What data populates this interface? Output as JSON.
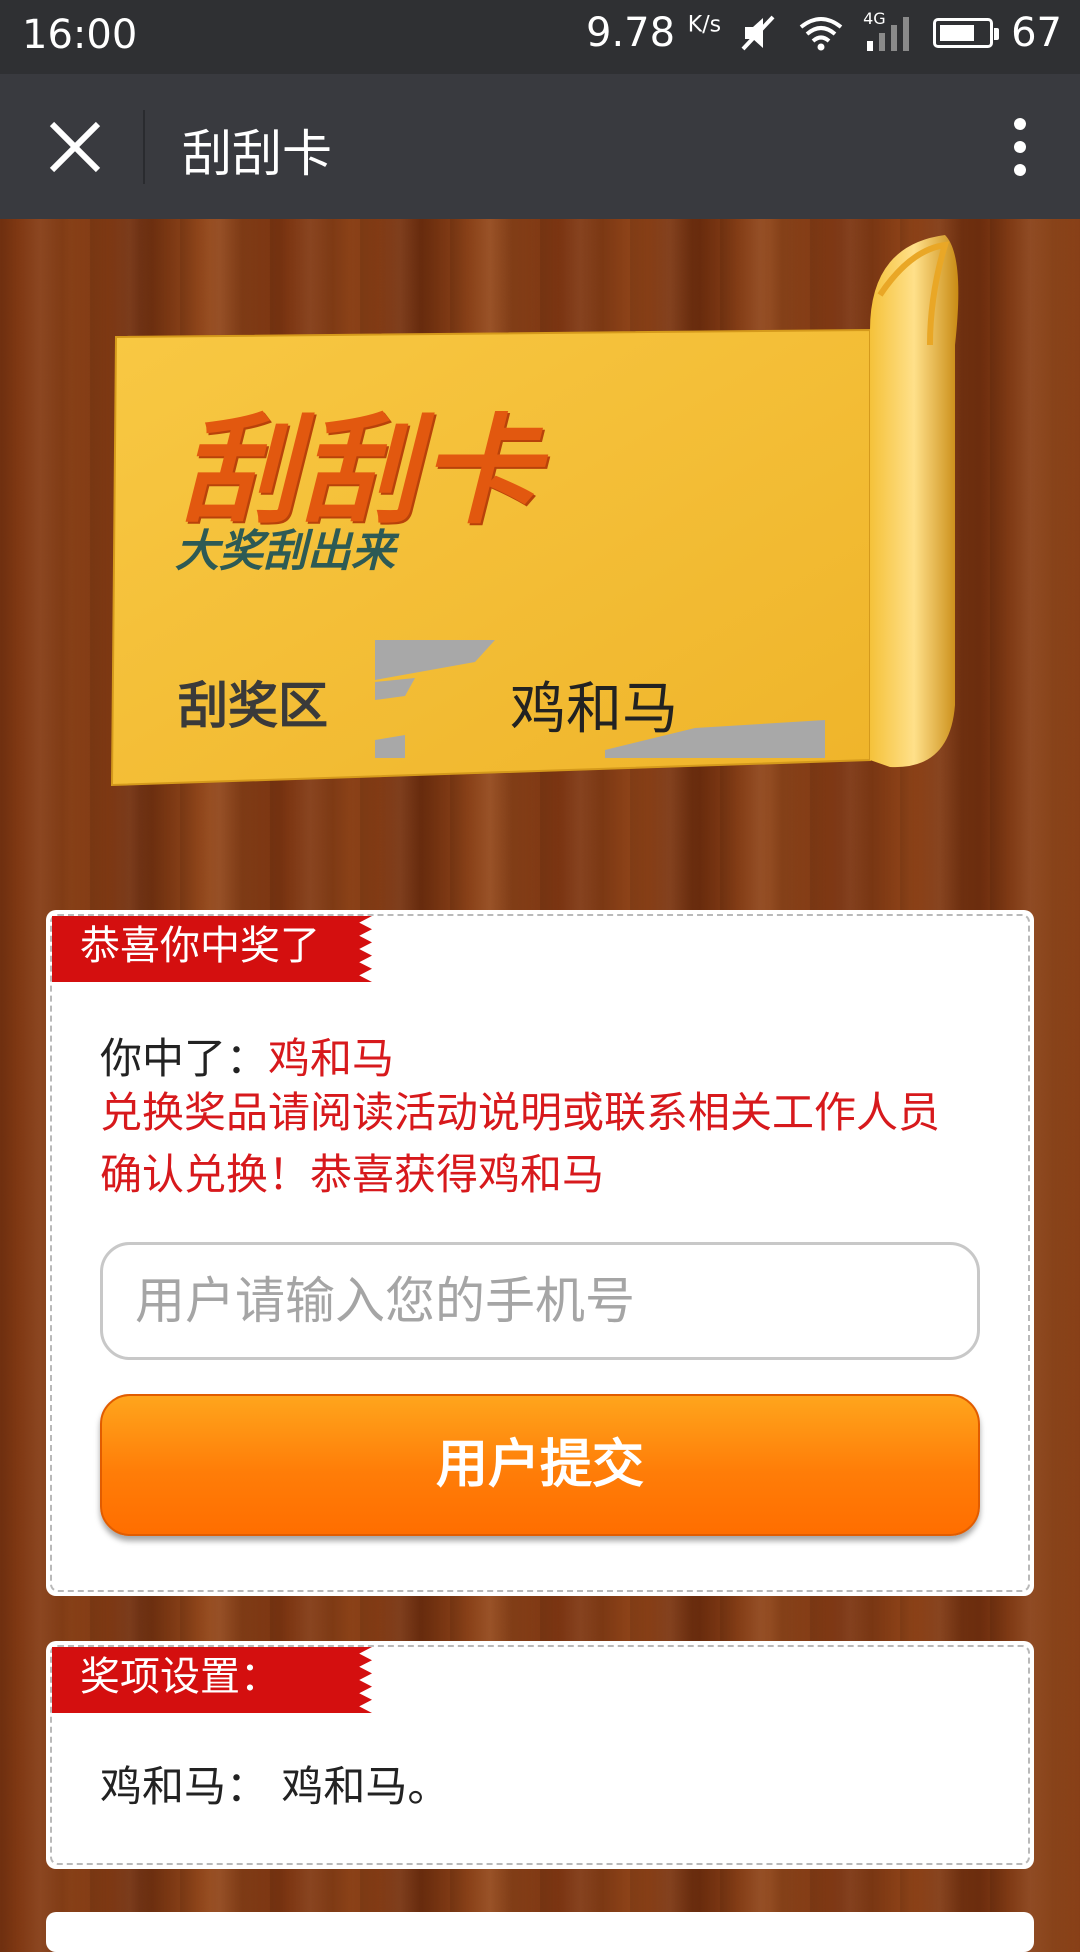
{
  "status_bar": {
    "time": "16:00",
    "network_speed": "9.78",
    "speed_unit": "K/s",
    "network_type": "4G",
    "battery": "67"
  },
  "nav": {
    "title": "刮刮卡"
  },
  "card": {
    "title": "刮刮卡",
    "subtitle": "大奖刮出来",
    "scratch_label": "刮奖区",
    "scratch_result": "鸡和马"
  },
  "win_panel": {
    "tag": "恭喜你中奖了",
    "won_prefix": "你中了：",
    "won_prize": "鸡和马",
    "instructions": "兑换奖品请阅读活动说明或联系相关工作人员确认兑换！恭喜获得鸡和马",
    "phone_placeholder": "用户请输入您的手机号",
    "submit_label": "用户提交"
  },
  "prize_panel": {
    "tag": "奖项设置：",
    "entry": "鸡和马：  鸡和马。"
  },
  "colors": {
    "accent_red": "#d40f0f",
    "submit_orange": "#ff7d08",
    "card_yellow": "#f3bd36"
  }
}
